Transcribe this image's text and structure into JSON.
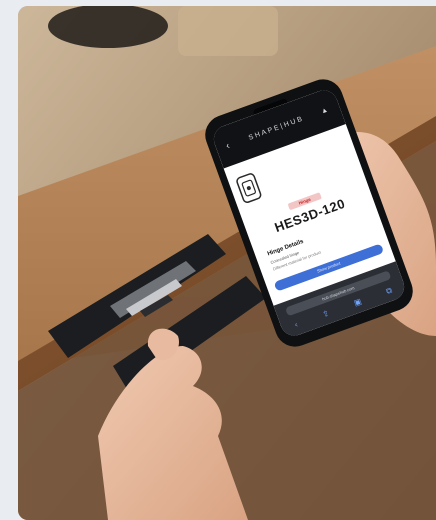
{
  "phone": {
    "brand": "SHAPE|HUB",
    "nav_back_icon": "chevron-left-icon",
    "nav_up_icon": "triangle-up-icon",
    "badge": "Hinge",
    "model": "HES3D-120",
    "details_title": "Hinge Details",
    "details_line1": "Concealed hinge",
    "details_line2": "Different material for product",
    "cta": "Show product",
    "url": "hub.shapehub.com",
    "toolbar_icons": [
      "chevron-left-icon",
      "share-icon",
      "book-icon",
      "tabs-icon"
    ]
  },
  "colors": {
    "page_bg": "#e9edf1",
    "wood": "#b48557",
    "wall": "#a98f72",
    "hinge": "#1b1d20",
    "phone_body": "#0f1012",
    "accent_blue": "#3d6fd6",
    "badge_red": "#c62828"
  }
}
